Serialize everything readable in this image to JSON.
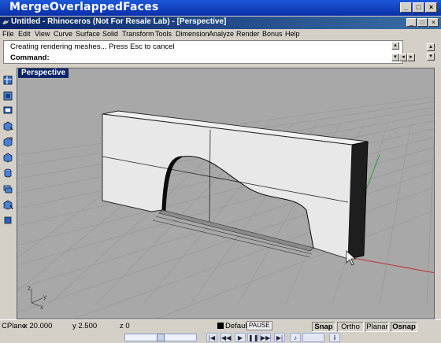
{
  "outer_window": {
    "title": "MergeOverlappedFaces"
  },
  "rhino_window": {
    "title": "Untitled - Rhinoceros (Not For Resale Lab) - [Perspective]"
  },
  "menu": {
    "items": [
      "File",
      "Edit",
      "View",
      "Curve",
      "Surface",
      "Solid",
      "Transform",
      "Tools",
      "Dimension",
      "Analyze",
      "Render",
      "Bonus",
      "Help"
    ]
  },
  "command": {
    "history": "Creating rendering meshes... Press Esc to cancel",
    "prompt": "Command:"
  },
  "viewport": {
    "label": "Perspective",
    "axis_labels": {
      "x": "x",
      "y": "y",
      "z": "z"
    }
  },
  "status": {
    "cplane": "CPlane",
    "x": "x 20.000",
    "y": "y 2.500",
    "z": "z 0",
    "layer": "Default",
    "pause": "PAUSE",
    "snap": "Snap",
    "ortho": "Ortho",
    "planar": "Planar",
    "osnap": "Osnap"
  },
  "player": {
    "info_icon": "i"
  },
  "colors": {
    "viewport_bg": "#a8a8a8",
    "grid_x_axis": "#c03030",
    "grid_y_axis": "#30a030",
    "title_bar": "#0a246a"
  }
}
